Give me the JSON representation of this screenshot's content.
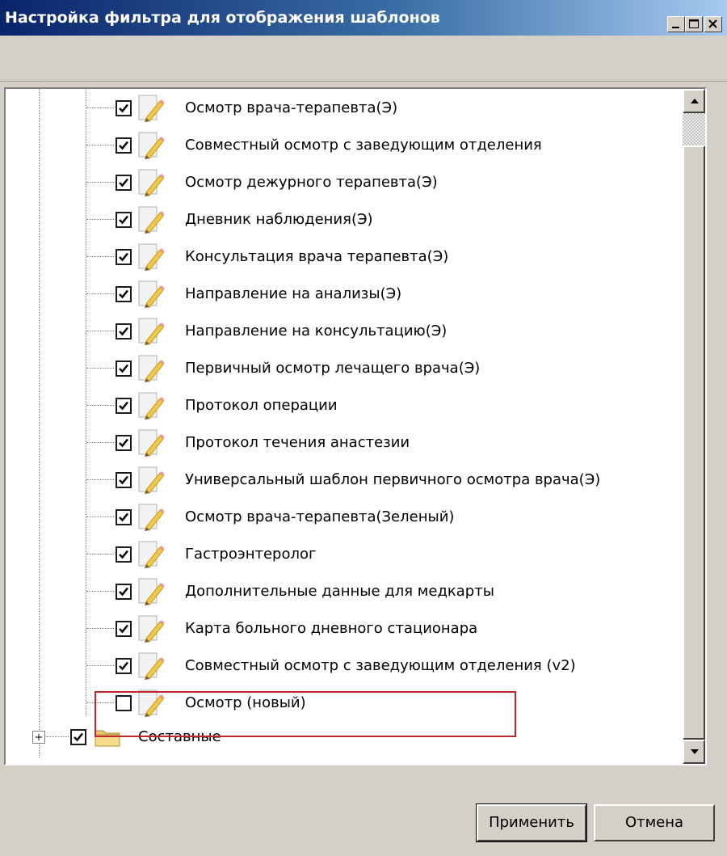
{
  "window": {
    "title": "Настройка фильтра для отображения шаблонов",
    "controls": [
      "minimize-icon",
      "maximize-icon",
      "close-icon"
    ]
  },
  "toolbar": {
    "expand_label": "+",
    "collapse_label": "−",
    "expand_enabled": false
  },
  "tree": {
    "items": [
      {
        "label": "Осмотр врача-терапевта(Э)",
        "checked": true
      },
      {
        "label": "Совместный осмотр с заведующим отделения",
        "checked": true
      },
      {
        "label": "Осмотр дежурного терапевта(Э)",
        "checked": true
      },
      {
        "label": "Дневник наблюдения(Э)",
        "checked": true
      },
      {
        "label": "Консультация врача терапевта(Э)",
        "checked": true
      },
      {
        "label": "Направление на анализы(Э)",
        "checked": true
      },
      {
        "label": "Направление на консультацию(Э)",
        "checked": true
      },
      {
        "label": "Первичный осмотр лечащего врача(Э)",
        "checked": true
      },
      {
        "label": "Протокол операции",
        "checked": true
      },
      {
        "label": "Протокол течения анастезии",
        "checked": true
      },
      {
        "label": "Универсальный шаблон первичного осмотра врача(Э)",
        "checked": true
      },
      {
        "label": "Осмотр врача-терапевта(Зеленый)",
        "checked": true
      },
      {
        "label": "Гастроэнтеролог",
        "checked": true
      },
      {
        "label": "Дополнительные данные для медкарты",
        "checked": true
      },
      {
        "label": "Карта больного дневного стационара",
        "checked": true
      },
      {
        "label": "Совместный осмотр с заведующим отделения (v2)",
        "checked": true
      },
      {
        "label": "Осмотр (новый)",
        "checked": false
      }
    ],
    "folder": {
      "label": "Составные",
      "checked": true,
      "expanded": false
    }
  },
  "colors": {
    "highlight_border": "#c0272d",
    "title_bar": "#0a246a"
  },
  "buttons": {
    "apply": "Применить",
    "cancel": "Отмена"
  }
}
